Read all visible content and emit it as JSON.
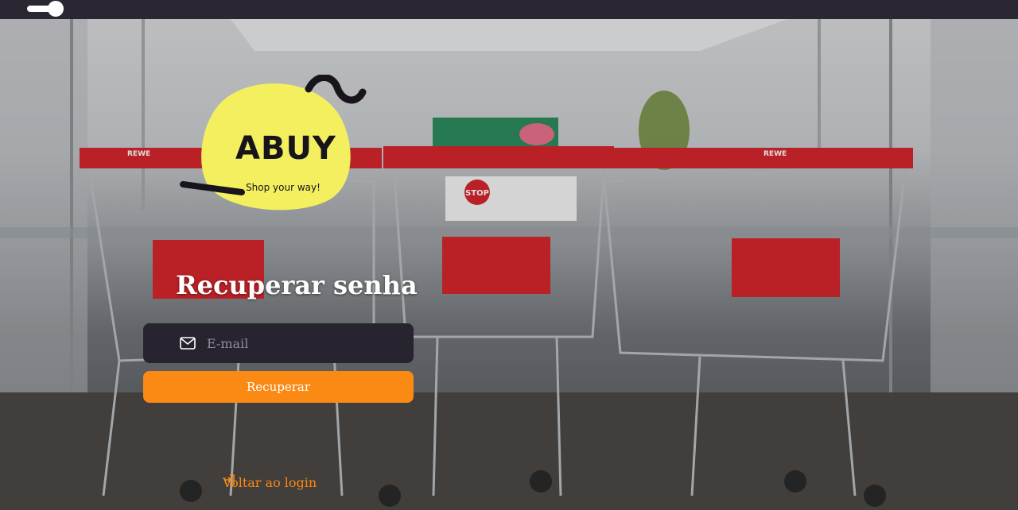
{
  "theme": {
    "accent": "#fb8a14",
    "topbar": "#2a2733",
    "field_bg": "#27242f",
    "logo_yellow": "#f3ef5f"
  },
  "topbar": {
    "toggle_state": "on"
  },
  "logo": {
    "title": "ABUY",
    "tagline": "Shop your way!"
  },
  "background": {
    "image_description": "shopping carts",
    "cart_brand": "REWE",
    "stop_sign": "STOP"
  },
  "form": {
    "title": "Recuperar senha",
    "email_placeholder": "E-mail",
    "email_value": "",
    "email_icon": "mail-icon",
    "submit_label": "Recuperar",
    "back_label": "Voltar ao login",
    "back_icon": "login-arrow-icon"
  }
}
